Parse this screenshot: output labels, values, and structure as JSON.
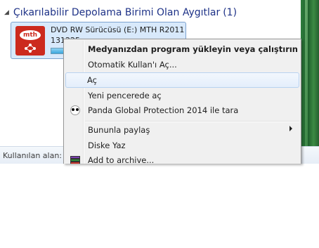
{
  "explorer": {
    "group": {
      "title": "Çıkarılabilir Depolama Birimi Olan Aygıtlar",
      "count": "(1)"
    },
    "drive": {
      "name": "DVD RW Sürücüsü (E:) MTH R2011",
      "sub": "131225",
      "icon_label": "mth",
      "icon": "dvd-drive-mth-icon"
    },
    "status": {
      "label": "Kullanılan alan:"
    }
  },
  "menu": {
    "items": [
      {
        "label": "Medyanızdan program yükleyin veya çalıştırın",
        "bold": true
      },
      {
        "label": "Otomatik Kullan'ı Aç..."
      },
      {
        "label": "Aç",
        "highlighted": true
      },
      {
        "label": "Yeni pencerede aç"
      },
      {
        "label": "Panda Global Protection 2014 ile tara",
        "icon": "panda-icon"
      },
      {
        "label": "Bununla paylaş",
        "submenu": true
      },
      {
        "label": "Diske Yaz"
      },
      {
        "label": "Add to archive...",
        "icon": "winrar-icon"
      }
    ]
  },
  "colors": {
    "menu_bg": "#f0f0f0",
    "highlight_border": "#b8d2f0",
    "group_title": "#1e3287",
    "tile_bg": "#d8e9fb",
    "drive_icon_red": "#cc2a1e"
  }
}
